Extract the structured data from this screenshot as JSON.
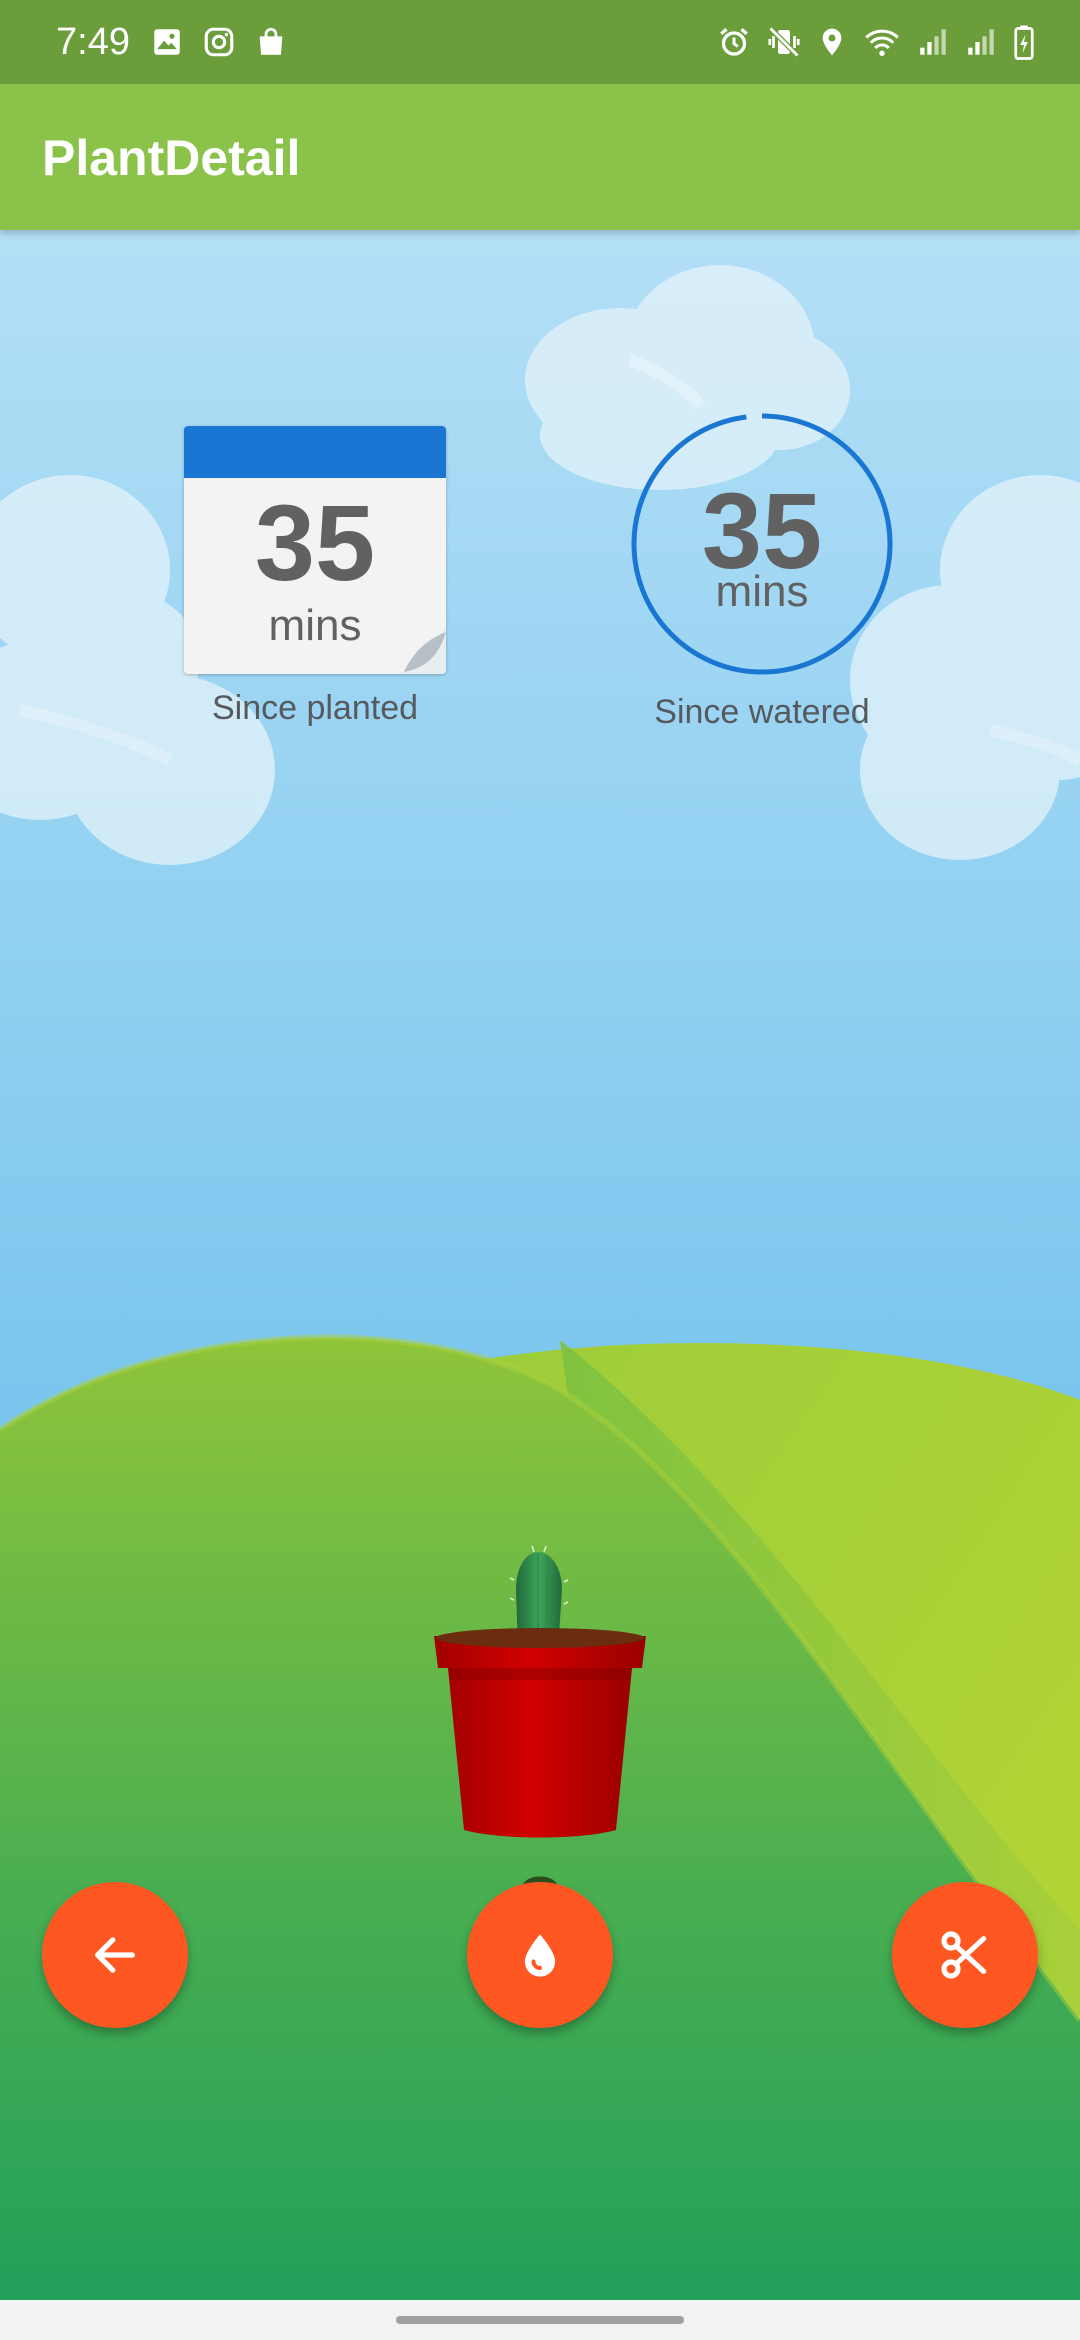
{
  "status_bar": {
    "time": "7:49",
    "left_icons": [
      "image-icon",
      "instagram-icon",
      "shopping-bag-icon"
    ],
    "right_icons": [
      "alarm-icon",
      "vibrate-icon",
      "location-icon",
      "wifi-icon",
      "signal-icon",
      "signal-icon",
      "battery-charging-icon"
    ]
  },
  "app_bar": {
    "title": "PlantDetail"
  },
  "planted": {
    "value": "35",
    "unit": "mins",
    "label": "Since planted"
  },
  "watered": {
    "value": "35",
    "unit": "mins",
    "label": "Since watered",
    "ring_progress": 0.98
  },
  "plant": {
    "count": "2"
  },
  "actions": {
    "back_icon": "arrow-back-icon",
    "water_icon": "water-drop-icon",
    "cut_icon": "scissors-icon"
  },
  "colors": {
    "app_bar": "#8bc34a",
    "status_bar": "#6b9e3a",
    "accent_fab": "#ff5722",
    "calendar_header": "#1976d2",
    "ring": "#1976d2",
    "pot": "#c60000"
  }
}
